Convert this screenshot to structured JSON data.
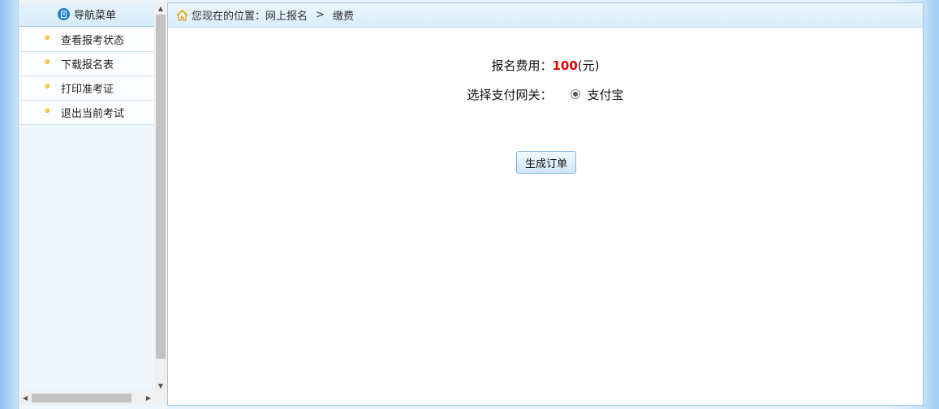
{
  "sidebar": {
    "header": {
      "title": "导航菜单",
      "icon": "list-icon"
    },
    "items": [
      {
        "label": "查看报考状态"
      },
      {
        "label": "下载报名表"
      },
      {
        "label": "打印准考证"
      },
      {
        "label": "退出当前考试"
      }
    ]
  },
  "breadcrumb": {
    "icon": "home-icon",
    "prefix": "您现在的位置：",
    "path": "网上报名",
    "separator": ">",
    "current": "缴费"
  },
  "payment": {
    "fee_label": "报名费用：",
    "fee_amount": "100",
    "fee_unit": "(元)",
    "gateway_label": "选择支付网关：",
    "gateway_option": "支付宝",
    "gateway_selected": true,
    "generate_button": "生成订单"
  },
  "colors": {
    "accent": "#1f7fd0",
    "fee_amount": "#e30000",
    "frame_border": "#9cc8e8"
  }
}
